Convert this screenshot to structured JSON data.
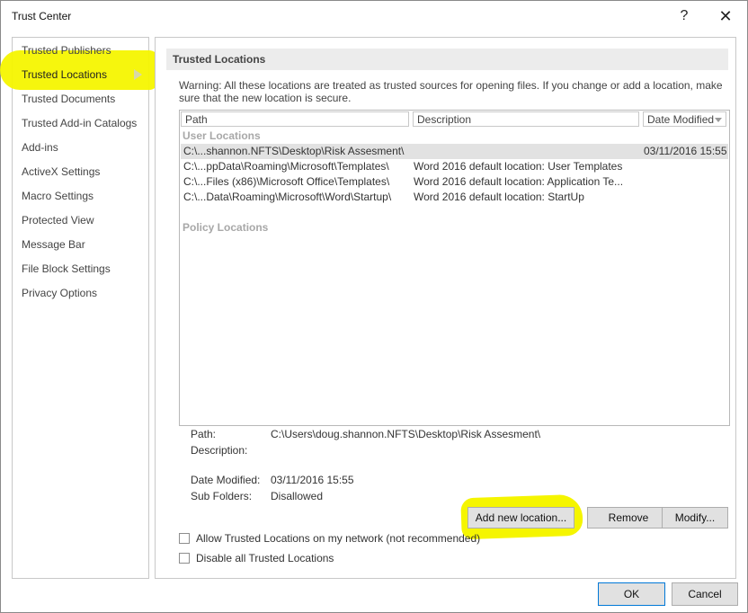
{
  "window": {
    "title": "Trust Center",
    "help_glyph": "?",
    "close_glyph": "✕"
  },
  "sidebar": {
    "items": [
      {
        "label": "Trusted Publishers"
      },
      {
        "label": "Trusted Locations"
      },
      {
        "label": "Trusted Documents"
      },
      {
        "label": "Trusted Add-in Catalogs"
      },
      {
        "label": "Add-ins"
      },
      {
        "label": "ActiveX Settings"
      },
      {
        "label": "Macro Settings"
      },
      {
        "label": "Protected View"
      },
      {
        "label": "Message Bar"
      },
      {
        "label": "File Block Settings"
      },
      {
        "label": "Privacy Options"
      }
    ],
    "selected": "Trusted Locations"
  },
  "main": {
    "section_title": "Trusted Locations",
    "warning": "Warning: All these locations are treated as trusted sources for opening files.  If you change or add a location, make sure that the new location is secure.",
    "columns": {
      "path": "Path",
      "description": "Description",
      "date_modified": "Date Modified"
    },
    "user_locations_label": "User Locations",
    "rows": [
      {
        "path": "C:\\...shannon.NFTS\\Desktop\\Risk Assesment\\",
        "description": "",
        "date": "03/11/2016 15:55"
      },
      {
        "path": "C:\\...ppData\\Roaming\\Microsoft\\Templates\\",
        "description": "Word 2016 default location: User Templates",
        "date": ""
      },
      {
        "path": "C:\\...Files (x86)\\Microsoft Office\\Templates\\",
        "description": "Word 2016 default location: Application Te...",
        "date": ""
      },
      {
        "path": "C:\\...Data\\Roaming\\Microsoft\\Word\\Startup\\",
        "description": "Word 2016 default location: StartUp",
        "date": ""
      }
    ],
    "policy_locations_label": "Policy Locations",
    "details": {
      "path_label": "Path:",
      "path_value": "C:\\Users\\doug.shannon.NFTS\\Desktop\\Risk Assesment\\",
      "description_label": "Description:",
      "date_label": "Date Modified:",
      "date_value": "03/11/2016 15:55",
      "subfolders_label": "Sub Folders:",
      "subfolders_value": "Disallowed"
    },
    "buttons": {
      "add": "Add new location...",
      "remove": "Remove",
      "modify": "Modify..."
    },
    "checkboxes": {
      "allow_network": "Allow Trusted Locations on my network (not recommended)",
      "disable_all": "Disable all Trusted Locations"
    }
  },
  "footer": {
    "ok": "OK",
    "cancel": "Cancel"
  },
  "colors": {
    "highlight": "#f5f500",
    "selected_row": "#e2e2e2",
    "section_header": "#ececec"
  }
}
